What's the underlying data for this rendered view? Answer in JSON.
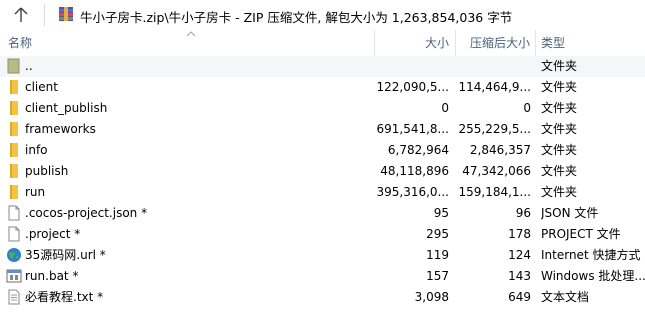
{
  "address": {
    "path": "牛小子房卡.zip\\牛小子房卡 - ZIP 压缩文件, 解包大小为 1,263,854,036 字节"
  },
  "columns": {
    "name": "名称",
    "size": "大小",
    "packed": "压缩后大小",
    "type": "类型"
  },
  "rows": [
    {
      "name": "..",
      "size": "",
      "packed": "",
      "type": "文件夹",
      "icon": "parent-folder-icon"
    },
    {
      "name": "client",
      "size": "122,090,5...",
      "packed": "114,464,9...",
      "type": "文件夹",
      "icon": "folder-icon"
    },
    {
      "name": "client_publish",
      "size": "0",
      "packed": "0",
      "type": "文件夹",
      "icon": "folder-icon"
    },
    {
      "name": "frameworks",
      "size": "691,541,8...",
      "packed": "255,229,5...",
      "type": "文件夹",
      "icon": "folder-icon"
    },
    {
      "name": "info",
      "size": "6,782,964",
      "packed": "2,846,357",
      "type": "文件夹",
      "icon": "folder-icon"
    },
    {
      "name": "publish",
      "size": "48,118,896",
      "packed": "47,342,066",
      "type": "文件夹",
      "icon": "folder-icon"
    },
    {
      "name": "run",
      "size": "395,316,0...",
      "packed": "159,184,1...",
      "type": "文件夹",
      "icon": "folder-icon"
    },
    {
      "name": ".cocos-project.json *",
      "size": "95",
      "packed": "96",
      "type": "JSON 文件",
      "icon": "file-icon"
    },
    {
      "name": ".project *",
      "size": "295",
      "packed": "178",
      "type": "PROJECT 文件",
      "icon": "file-icon"
    },
    {
      "name": "35源码网.url *",
      "size": "119",
      "packed": "124",
      "type": "Internet 快捷方式",
      "icon": "globe-icon"
    },
    {
      "name": "run.bat *",
      "size": "157",
      "packed": "143",
      "type": "Windows 批处理...",
      "icon": "bat-icon"
    },
    {
      "name": "必看教程.txt *",
      "size": "3,098",
      "packed": "649",
      "type": "文本文档",
      "icon": "text-file-icon"
    }
  ],
  "colors": {
    "folder": "#f5c342",
    "header_text": "#4c607a",
    "parent_row_bg": "#f5f6f8"
  }
}
